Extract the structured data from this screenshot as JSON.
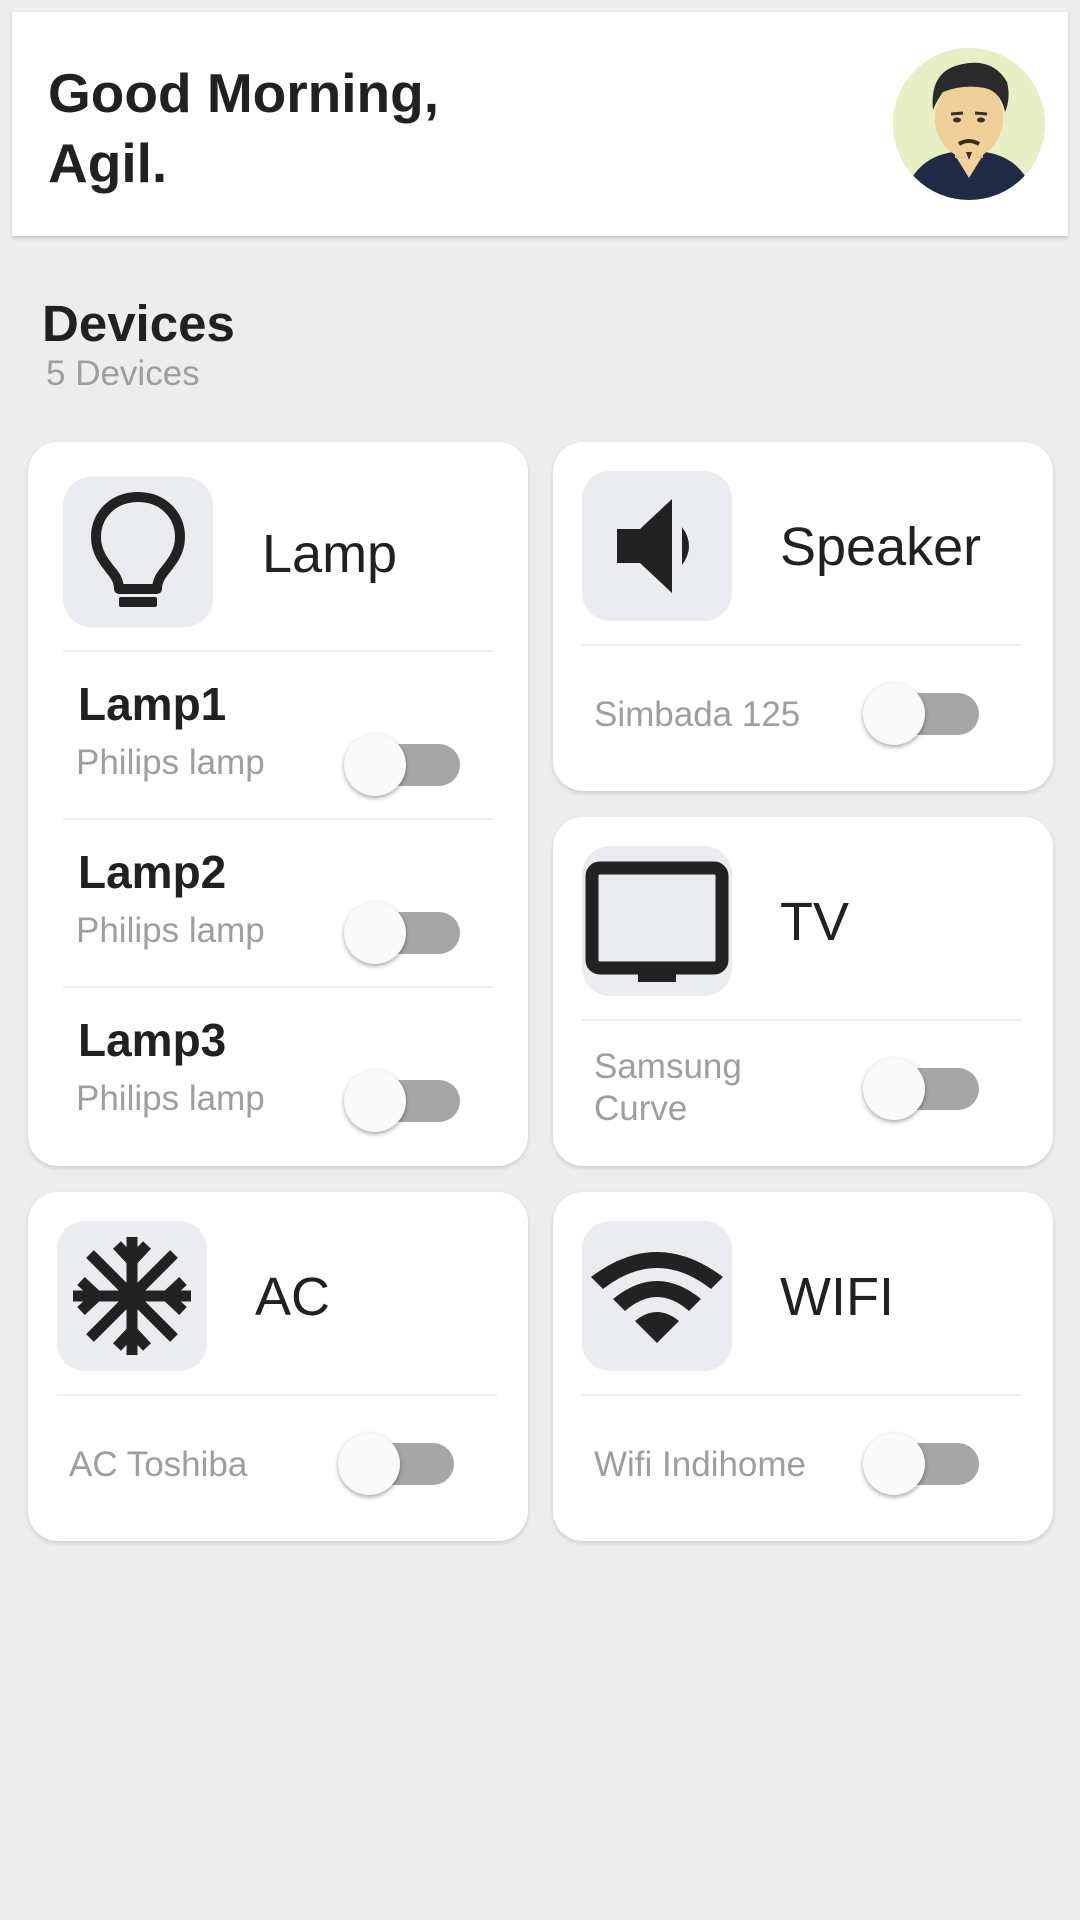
{
  "header": {
    "greeting_line1": "Good Morning,",
    "greeting_line2": "Agil."
  },
  "devices_section": {
    "title": "Devices",
    "count_text": "5 Devices"
  },
  "colors": {
    "background": "#ededed",
    "card": "#ffffff",
    "icon_box": "#eaecef",
    "toggle_track": "#a6a6a6",
    "toggle_thumb": "#fafafa",
    "muted_text": "#9e9e9e"
  },
  "cards": {
    "lamp": {
      "title": "Lamp",
      "icon": "lightbulb-icon",
      "items": [
        {
          "name": "Lamp1",
          "desc": "Philips lamp",
          "on": false
        },
        {
          "name": "Lamp2",
          "desc": "Philips lamp",
          "on": false
        },
        {
          "name": "Lamp3",
          "desc": "Philips lamp",
          "on": false
        }
      ]
    },
    "speaker": {
      "title": "Speaker",
      "icon": "speaker-icon",
      "items": [
        {
          "desc": "Simbada 125",
          "on": false
        }
      ]
    },
    "tv": {
      "title": "TV",
      "icon": "tv-icon",
      "items": [
        {
          "desc_line1": "Samsung",
          "desc_line2": "Curve",
          "on": false
        }
      ]
    },
    "ac": {
      "title": "AC",
      "icon": "snowflake-icon",
      "items": [
        {
          "desc": "AC Toshiba",
          "on": false
        }
      ]
    },
    "wifi": {
      "title": "WIFI",
      "icon": "wifi-icon",
      "items": [
        {
          "desc": "Wifi Indihome",
          "on": false
        }
      ]
    }
  }
}
